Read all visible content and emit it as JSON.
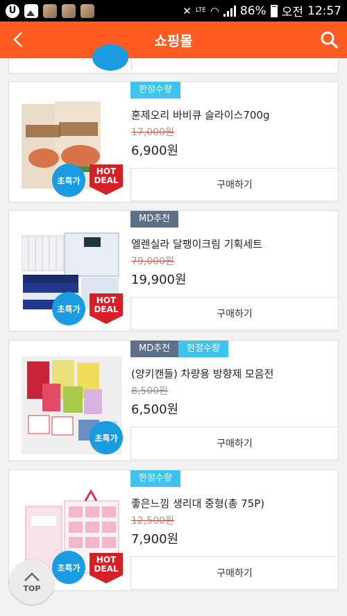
{
  "status_bar": {
    "battery": "86%",
    "carrier": "오전",
    "time": "12:57",
    "network": "LTE",
    "left_icon_letter": "U"
  },
  "header": {
    "title": "쇼핑몰"
  },
  "products": [
    {
      "tags": [
        "한정수량"
      ],
      "name": "훈제오리 바비큐 슬라이스700g",
      "original_price": "17,000원",
      "price": "6,900원",
      "buy_label": "구매하기",
      "badge": "초특가",
      "hot_deal": [
        "HOT",
        "DEAL"
      ]
    },
    {
      "tags": [
        "MD추천"
      ],
      "name": "엘렌실라 달팽이크림 기획세트",
      "original_price": "79,000원",
      "price": "19,900원",
      "buy_label": "구매하기",
      "badge": "초특가",
      "hot_deal": [
        "HOT",
        "DEAL"
      ]
    },
    {
      "tags": [
        "MD추천",
        "한정수량"
      ],
      "name": "(양키캔들) 차량용 방향제 모음전",
      "original_price": "8,500원",
      "price": "6,500원",
      "buy_label": "구매하기",
      "badge": "초특가",
      "hot_deal": null
    },
    {
      "tags": [
        "한정수량"
      ],
      "name": "좋은느낌 생리대 중형(총 75P)",
      "original_price": "12,500원",
      "price": "7,900원",
      "buy_label": "구매하기",
      "badge": "초특가",
      "hot_deal": [
        "HOT",
        "DEAL"
      ]
    }
  ],
  "top_button": {
    "label": "TOP"
  },
  "colors": {
    "header": "#ff5a1f",
    "badge_blue": "#1a9ce3",
    "hot_red": "#d81f26",
    "tag_limited": "#3cc3ee",
    "tag_md": "#5d7086"
  }
}
